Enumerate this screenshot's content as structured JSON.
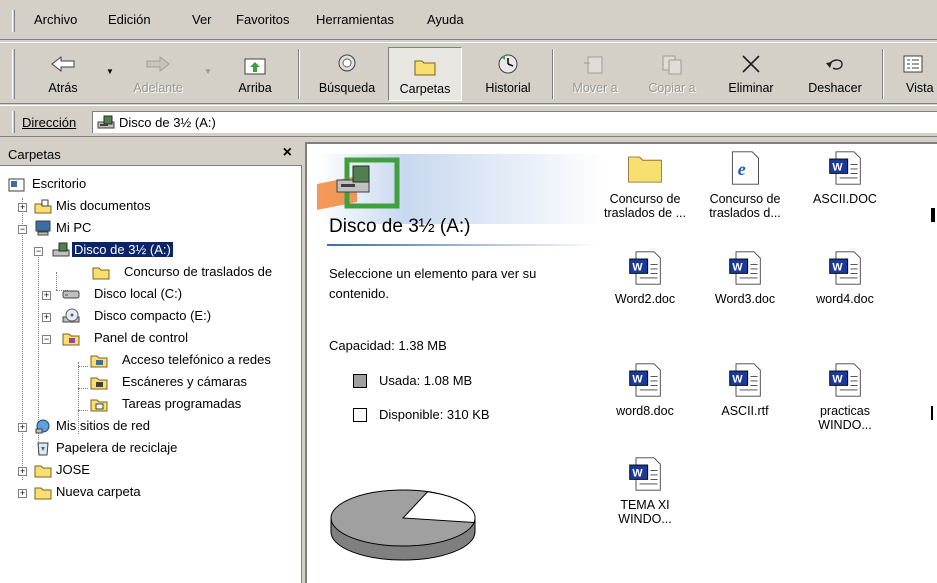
{
  "menu": [
    "Archivo",
    "Edición",
    "Ver",
    "Favoritos",
    "Herramientas",
    "Ayuda"
  ],
  "toolbar": {
    "back": "Atrás",
    "forward": "Adelante",
    "up": "Arriba",
    "search": "Búsqueda",
    "folders": "Carpetas",
    "history": "Historial",
    "move": "Mover a",
    "copy": "Copiar a",
    "delete": "Eliminar",
    "undo": "Deshacer",
    "views": "Vista"
  },
  "address": {
    "label": "Dirección",
    "value": "Disco de 3½ (A:)"
  },
  "folders_pane": {
    "title": "Carpetas",
    "close": "×",
    "tree": [
      "Escritorio",
      "Mis documentos",
      "Mi PC",
      "Disco de 3½ (A:)",
      "Concurso de traslados de",
      "Disco local (C:)",
      "Disco compacto (E:)",
      "Panel de control",
      "Acceso telefónico a redes",
      "Escáneres y cámaras",
      "Tareas programadas",
      "Mis sitios de red",
      "Papelera de reciclaje",
      "JOSE",
      "Nueva carpeta"
    ]
  },
  "info": {
    "title": "Disco de 3½ (A:)",
    "hint_1": "Seleccione un elemento para ver su",
    "hint_2": "contenido.",
    "capacity": "Capacidad: 1.38 MB",
    "used": "Usada: 1.08 MB",
    "free": "Disponible: 310 KB",
    "used_fraction": 0.78
  },
  "files": [
    {
      "name_1": "Concurso de",
      "name_2": "traslados de ...",
      "icon": "folder-icon"
    },
    {
      "name_1": "Concurso de",
      "name_2": "traslados d...",
      "icon": "ie-document-icon"
    },
    {
      "name_1": "ASCII.DOC",
      "name_2": "",
      "icon": "word-document-icon"
    },
    {
      "name_1": "Word2.doc",
      "name_2": "",
      "icon": "word-document-icon"
    },
    {
      "name_1": "Word3.doc",
      "name_2": "",
      "icon": "word-document-icon"
    },
    {
      "name_1": "word4.doc",
      "name_2": "",
      "icon": "word-document-icon"
    },
    {
      "name_1": "word8.doc",
      "name_2": "",
      "icon": "word-document-icon"
    },
    {
      "name_1": "ASCII.rtf",
      "name_2": "",
      "icon": "word-document-icon"
    },
    {
      "name_1": "practicas",
      "name_2": "WINDO...",
      "icon": "word-document-icon"
    },
    {
      "name_1": "TEMA XI",
      "name_2": "WINDO...",
      "icon": "word-document-icon"
    }
  ],
  "colors": {
    "selection": "#0a246a",
    "chrome": "#d4d0c8",
    "used": "#a0a0a0",
    "free": "#ffffff"
  }
}
